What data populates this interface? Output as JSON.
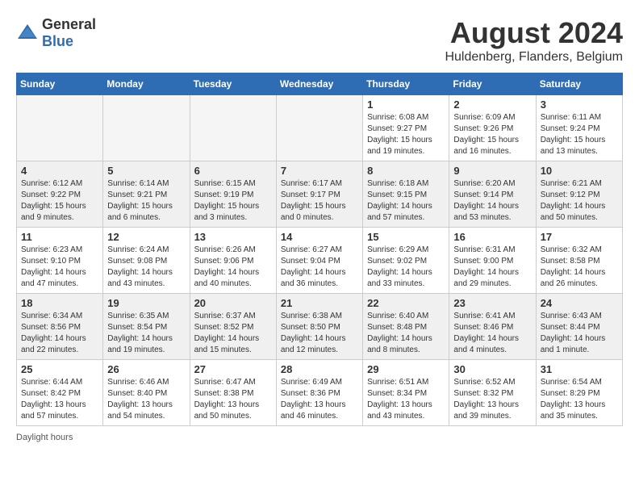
{
  "header": {
    "logo_general": "General",
    "logo_blue": "Blue",
    "month_year": "August 2024",
    "location": "Huldenberg, Flanders, Belgium"
  },
  "days_of_week": [
    "Sunday",
    "Monday",
    "Tuesday",
    "Wednesday",
    "Thursday",
    "Friday",
    "Saturday"
  ],
  "weeks": [
    [
      {
        "day": "",
        "empty": true
      },
      {
        "day": "",
        "empty": true
      },
      {
        "day": "",
        "empty": true
      },
      {
        "day": "",
        "empty": true
      },
      {
        "day": "1",
        "sunrise": "6:08 AM",
        "sunset": "9:27 PM",
        "daylight": "15 hours and 19 minutes."
      },
      {
        "day": "2",
        "sunrise": "6:09 AM",
        "sunset": "9:26 PM",
        "daylight": "15 hours and 16 minutes."
      },
      {
        "day": "3",
        "sunrise": "6:11 AM",
        "sunset": "9:24 PM",
        "daylight": "15 hours and 13 minutes."
      }
    ],
    [
      {
        "day": "4",
        "sunrise": "6:12 AM",
        "sunset": "9:22 PM",
        "daylight": "15 hours and 9 minutes."
      },
      {
        "day": "5",
        "sunrise": "6:14 AM",
        "sunset": "9:21 PM",
        "daylight": "15 hours and 6 minutes."
      },
      {
        "day": "6",
        "sunrise": "6:15 AM",
        "sunset": "9:19 PM",
        "daylight": "15 hours and 3 minutes."
      },
      {
        "day": "7",
        "sunrise": "6:17 AM",
        "sunset": "9:17 PM",
        "daylight": "15 hours and 0 minutes."
      },
      {
        "day": "8",
        "sunrise": "6:18 AM",
        "sunset": "9:15 PM",
        "daylight": "14 hours and 57 minutes."
      },
      {
        "day": "9",
        "sunrise": "6:20 AM",
        "sunset": "9:14 PM",
        "daylight": "14 hours and 53 minutes."
      },
      {
        "day": "10",
        "sunrise": "6:21 AM",
        "sunset": "9:12 PM",
        "daylight": "14 hours and 50 minutes."
      }
    ],
    [
      {
        "day": "11",
        "sunrise": "6:23 AM",
        "sunset": "9:10 PM",
        "daylight": "14 hours and 47 minutes."
      },
      {
        "day": "12",
        "sunrise": "6:24 AM",
        "sunset": "9:08 PM",
        "daylight": "14 hours and 43 minutes."
      },
      {
        "day": "13",
        "sunrise": "6:26 AM",
        "sunset": "9:06 PM",
        "daylight": "14 hours and 40 minutes."
      },
      {
        "day": "14",
        "sunrise": "6:27 AM",
        "sunset": "9:04 PM",
        "daylight": "14 hours and 36 minutes."
      },
      {
        "day": "15",
        "sunrise": "6:29 AM",
        "sunset": "9:02 PM",
        "daylight": "14 hours and 33 minutes."
      },
      {
        "day": "16",
        "sunrise": "6:31 AM",
        "sunset": "9:00 PM",
        "daylight": "14 hours and 29 minutes."
      },
      {
        "day": "17",
        "sunrise": "6:32 AM",
        "sunset": "8:58 PM",
        "daylight": "14 hours and 26 minutes."
      }
    ],
    [
      {
        "day": "18",
        "sunrise": "6:34 AM",
        "sunset": "8:56 PM",
        "daylight": "14 hours and 22 minutes."
      },
      {
        "day": "19",
        "sunrise": "6:35 AM",
        "sunset": "8:54 PM",
        "daylight": "14 hours and 19 minutes."
      },
      {
        "day": "20",
        "sunrise": "6:37 AM",
        "sunset": "8:52 PM",
        "daylight": "14 hours and 15 minutes."
      },
      {
        "day": "21",
        "sunrise": "6:38 AM",
        "sunset": "8:50 PM",
        "daylight": "14 hours and 12 minutes."
      },
      {
        "day": "22",
        "sunrise": "6:40 AM",
        "sunset": "8:48 PM",
        "daylight": "14 hours and 8 minutes."
      },
      {
        "day": "23",
        "sunrise": "6:41 AM",
        "sunset": "8:46 PM",
        "daylight": "14 hours and 4 minutes."
      },
      {
        "day": "24",
        "sunrise": "6:43 AM",
        "sunset": "8:44 PM",
        "daylight": "14 hours and 1 minute."
      }
    ],
    [
      {
        "day": "25",
        "sunrise": "6:44 AM",
        "sunset": "8:42 PM",
        "daylight": "13 hours and 57 minutes."
      },
      {
        "day": "26",
        "sunrise": "6:46 AM",
        "sunset": "8:40 PM",
        "daylight": "13 hours and 54 minutes."
      },
      {
        "day": "27",
        "sunrise": "6:47 AM",
        "sunset": "8:38 PM",
        "daylight": "13 hours and 50 minutes."
      },
      {
        "day": "28",
        "sunrise": "6:49 AM",
        "sunset": "8:36 PM",
        "daylight": "13 hours and 46 minutes."
      },
      {
        "day": "29",
        "sunrise": "6:51 AM",
        "sunset": "8:34 PM",
        "daylight": "13 hours and 43 minutes."
      },
      {
        "day": "30",
        "sunrise": "6:52 AM",
        "sunset": "8:32 PM",
        "daylight": "13 hours and 39 minutes."
      },
      {
        "day": "31",
        "sunrise": "6:54 AM",
        "sunset": "8:29 PM",
        "daylight": "13 hours and 35 minutes."
      }
    ]
  ],
  "labels": {
    "sunrise_label": "Sunrise:",
    "sunset_label": "Sunset:",
    "daylight_label": "Daylight:"
  },
  "footer": {
    "daylight_hours": "Daylight hours"
  }
}
